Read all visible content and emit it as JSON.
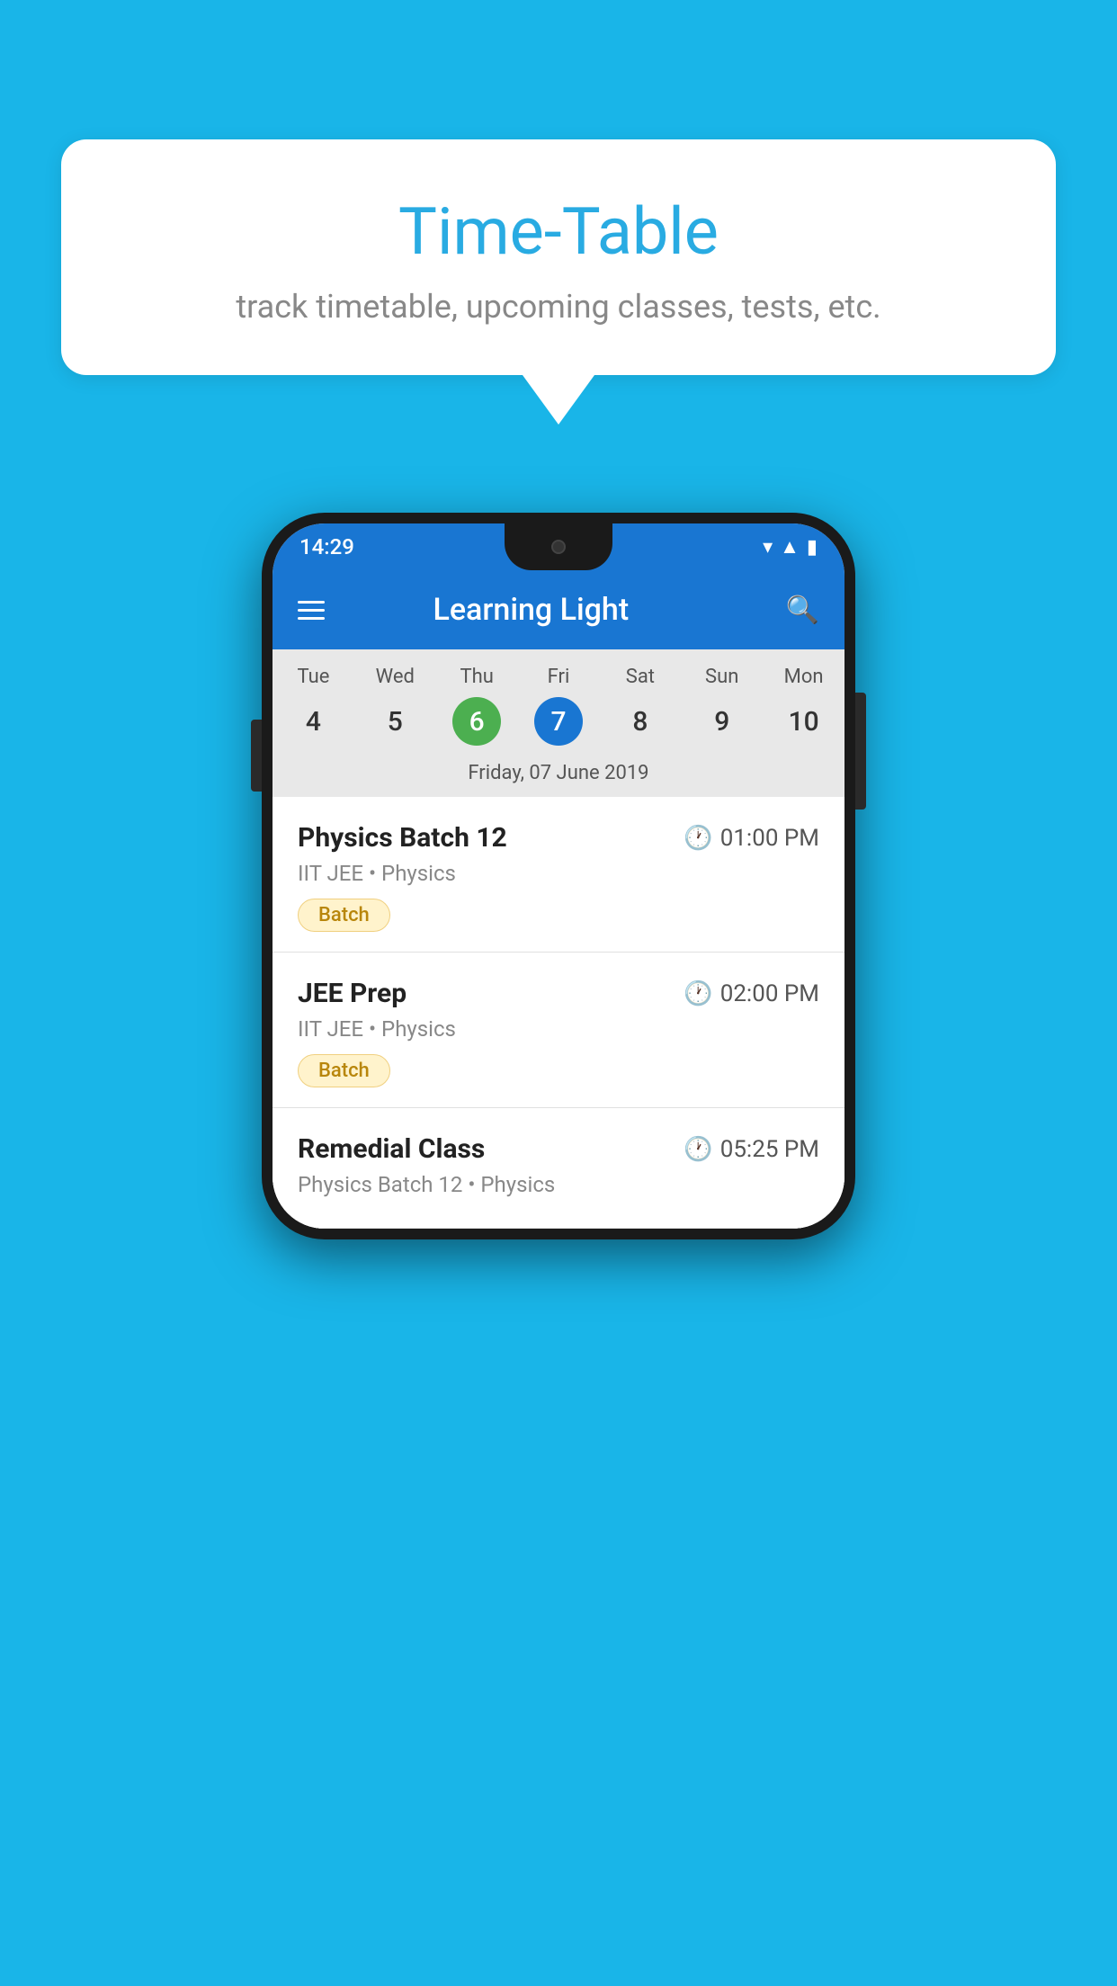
{
  "background_color": "#19B5E8",
  "speech_bubble": {
    "title": "Time-Table",
    "subtitle": "track timetable, upcoming classes, tests, etc."
  },
  "phone": {
    "status_bar": {
      "time": "14:29",
      "icons": [
        "wifi",
        "signal",
        "battery"
      ]
    },
    "app_bar": {
      "title": "Learning Light",
      "menu_icon": "hamburger",
      "search_icon": "search"
    },
    "calendar": {
      "days": [
        {
          "name": "Tue",
          "num": "4",
          "state": "normal"
        },
        {
          "name": "Wed",
          "num": "5",
          "state": "normal"
        },
        {
          "name": "Thu",
          "num": "6",
          "state": "today"
        },
        {
          "name": "Fri",
          "num": "7",
          "state": "selected"
        },
        {
          "name": "Sat",
          "num": "8",
          "state": "normal"
        },
        {
          "name": "Sun",
          "num": "9",
          "state": "normal"
        },
        {
          "name": "Mon",
          "num": "10",
          "state": "normal"
        }
      ],
      "selected_date_label": "Friday, 07 June 2019"
    },
    "schedule_items": [
      {
        "title": "Physics Batch 12",
        "time": "01:00 PM",
        "subtitle": "IIT JEE • Physics",
        "tag": "Batch"
      },
      {
        "title": "JEE Prep",
        "time": "02:00 PM",
        "subtitle": "IIT JEE • Physics",
        "tag": "Batch"
      },
      {
        "title": "Remedial Class",
        "time": "05:25 PM",
        "subtitle": "Physics Batch 12 • Physics",
        "tag": null
      }
    ]
  }
}
